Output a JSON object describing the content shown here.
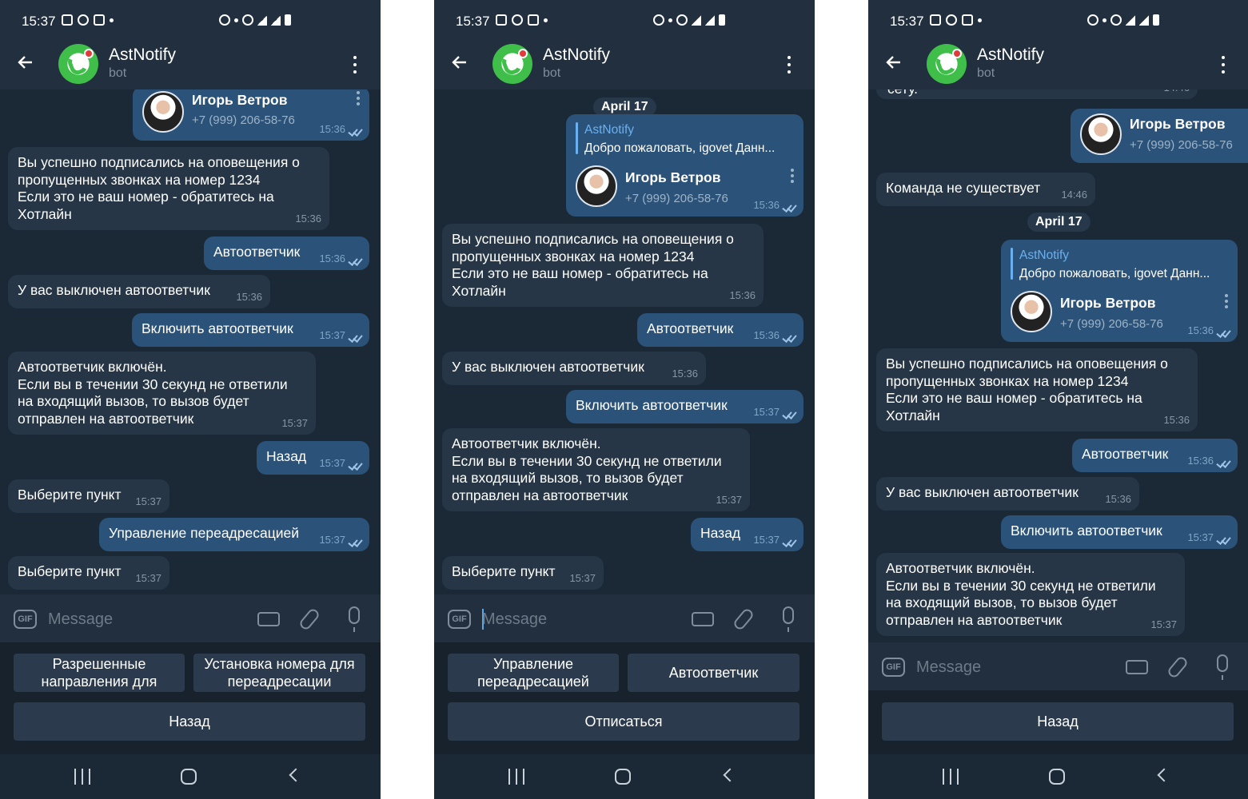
{
  "status": {
    "time": "15:37"
  },
  "header": {
    "title": "AstNotify",
    "subtitle": "bot"
  },
  "contact": {
    "name": "Игорь Ветров",
    "phone": "+7 (999) 206-58-76"
  },
  "reply": {
    "name": "AstNotify",
    "text": "Добро пожаловать, igovet  Данн..."
  },
  "messages": {
    "subscribed": [
      "Вы успешно подписались на оповещения о",
      "пропущенных звонках на номер 1234",
      "Если это не ваш номер - обратитесь на",
      "Хотлайн"
    ],
    "autoresponder": "Автоответчик",
    "autoresponder_off": "У вас выключен автоответчик",
    "enable_autoresponder": "Включить автоответчик",
    "autoresponder_on": [
      "Автоответчик включён.",
      "Если вы в течении 30 секунд не ответили",
      "на входящий вызов, то вызов будет",
      "отправлен на автоответчик"
    ],
    "back": "Назад",
    "choose_item": "Выберите пункт",
    "manage_forwarding": "Управление переадресацией",
    "command_not_exist": "Команда не существует",
    "cut_text": "сету."
  },
  "times": {
    "t1536": "15:36",
    "t1537": "15:37",
    "t1446": "14:46"
  },
  "date_pill": "April 17",
  "input": {
    "placeholder": "Message",
    "gif": "GIF"
  },
  "keyboards": {
    "left": {
      "btn1": "Разрешенные направления для",
      "btn2": "Установка номера для переадресации",
      "btn3": "Назад"
    },
    "middle": {
      "btn1": "Управление переадресацией",
      "btn2": "Автоответчик",
      "btn3": "Отписаться"
    },
    "right": {
      "btn1": "Назад"
    }
  }
}
